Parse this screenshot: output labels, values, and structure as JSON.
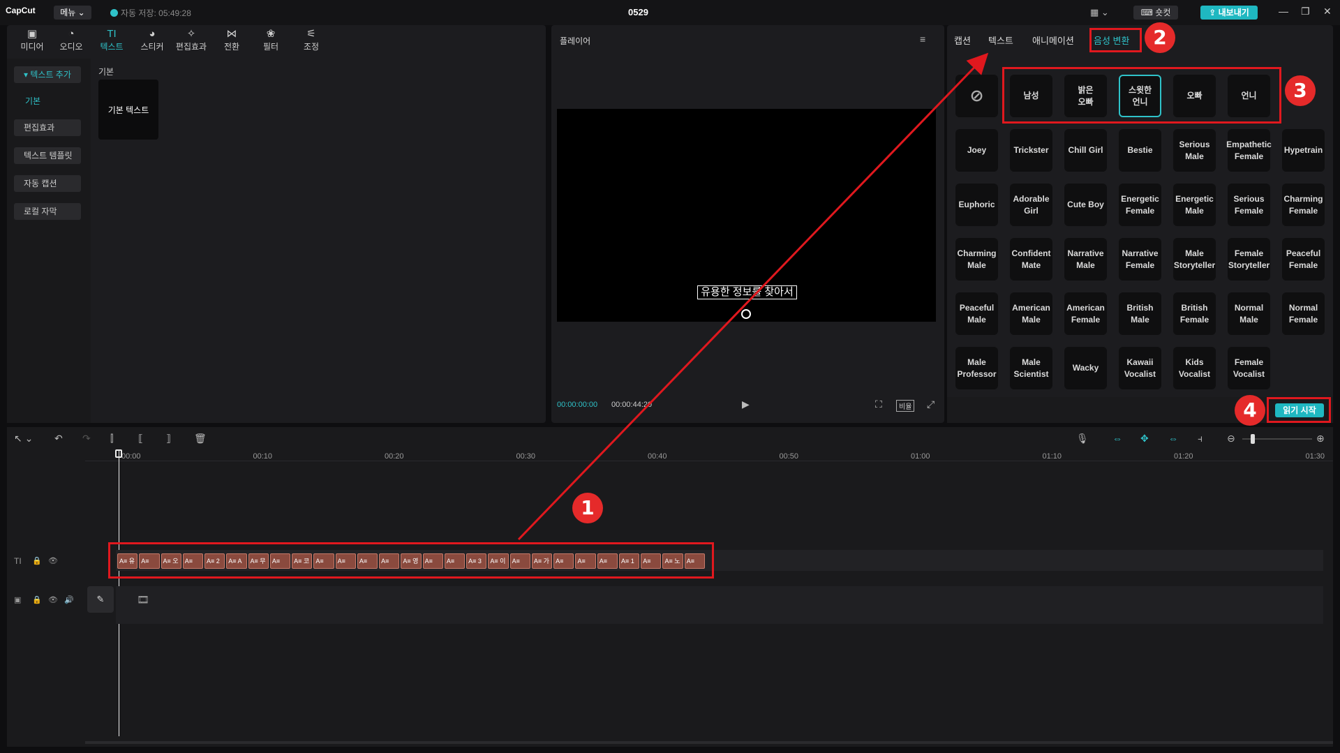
{
  "app": {
    "logo": "CapCut",
    "menu": "메뉴 ⌄",
    "autosave": "자동 저장: 05:49:28",
    "project_title": "0529",
    "shortcut": "숏컷",
    "export": "내보내기"
  },
  "tool_tabs": [
    {
      "label": "미디어",
      "icon": "▣"
    },
    {
      "label": "오디오",
      "icon": "◔"
    },
    {
      "label": "텍스트",
      "icon": "TI"
    },
    {
      "label": "스티커",
      "icon": "◕"
    },
    {
      "label": "편집효과",
      "icon": "✧"
    },
    {
      "label": "전환",
      "icon": "⋈"
    },
    {
      "label": "필터",
      "icon": "❀"
    },
    {
      "label": "조정",
      "icon": "⚟"
    }
  ],
  "sidebar": {
    "items": [
      "▾ 텍스트 추가",
      "기본",
      "편집효과",
      "텍스트 템플릿",
      "자동 캡션",
      "로컬 자막"
    ]
  },
  "text_panel": {
    "section": "기본",
    "card": "기본 텍스트"
  },
  "player": {
    "title": "플레이어",
    "caption": "유용한 정보를 찾아서",
    "time_current": "00:00:00:00",
    "time_total": "00:00:44:20",
    "ratio": "비율"
  },
  "right_tabs": [
    "캡션",
    "텍스트",
    "애니메이션",
    "음성 변환"
  ],
  "voices": {
    "row1": [
      "남성",
      "밝은\n오빠",
      "스윗한\n언니",
      "오빠",
      "언니"
    ],
    "grid": [
      [
        "Joey",
        "Trickster",
        "Chill Girl",
        "Bestie",
        "Serious\nMale",
        "Empathetic\nFemale",
        "Hypetrain"
      ],
      [
        "Euphoric",
        "Adorable\nGirl",
        "Cute Boy",
        "Energetic\nFemale",
        "Energetic\nMale",
        "Serious\nFemale",
        "Charming\nFemale"
      ],
      [
        "Charming\nMale",
        "Confident\nMate",
        "Narrative\nMale",
        "Narrative\nFemale",
        "Male\nStoryteller",
        "Female\nStoryteller",
        "Peaceful\nFemale"
      ],
      [
        "Peaceful\nMale",
        "American\nMale",
        "American\nFemale",
        "British\nMale",
        "British\nFemale",
        "Normal\nMale",
        "Normal\nFemale"
      ],
      [
        "Male\nProfessor",
        "Male\nScientist",
        "Wacky",
        "Kawaii\nVocalist",
        "Kids\nVocalist",
        "Female\nVocalist"
      ]
    ]
  },
  "start_button": "읽기 시작",
  "badges": [
    "1",
    "2",
    "3",
    "4"
  ],
  "ruler": [
    "00:00",
    "00:10",
    "00:20",
    "00:30",
    "00:40",
    "00:50",
    "01:00",
    "01:10",
    "01:20",
    "01:30"
  ],
  "clips": [
    "A≡ 유",
    "A≡",
    "A≡ 오",
    "A≡",
    "A≡ 2",
    "A≡ A",
    "A≡ 무",
    "A≡",
    "A≡ 코",
    "A≡",
    "A≡",
    "A≡",
    "A≡",
    "A≡ 영",
    "A≡",
    "A≡",
    "A≡ 3",
    "A≡ 이",
    "A≡",
    "A≡ 가",
    "A≡",
    "A≡",
    "A≡",
    "A≡ 1",
    "A≡",
    "A≡ 노",
    "A≡"
  ],
  "colors": {
    "accent": "#2fc2c9",
    "annotation": "#e0181e",
    "clip": "#8a4a3e"
  }
}
